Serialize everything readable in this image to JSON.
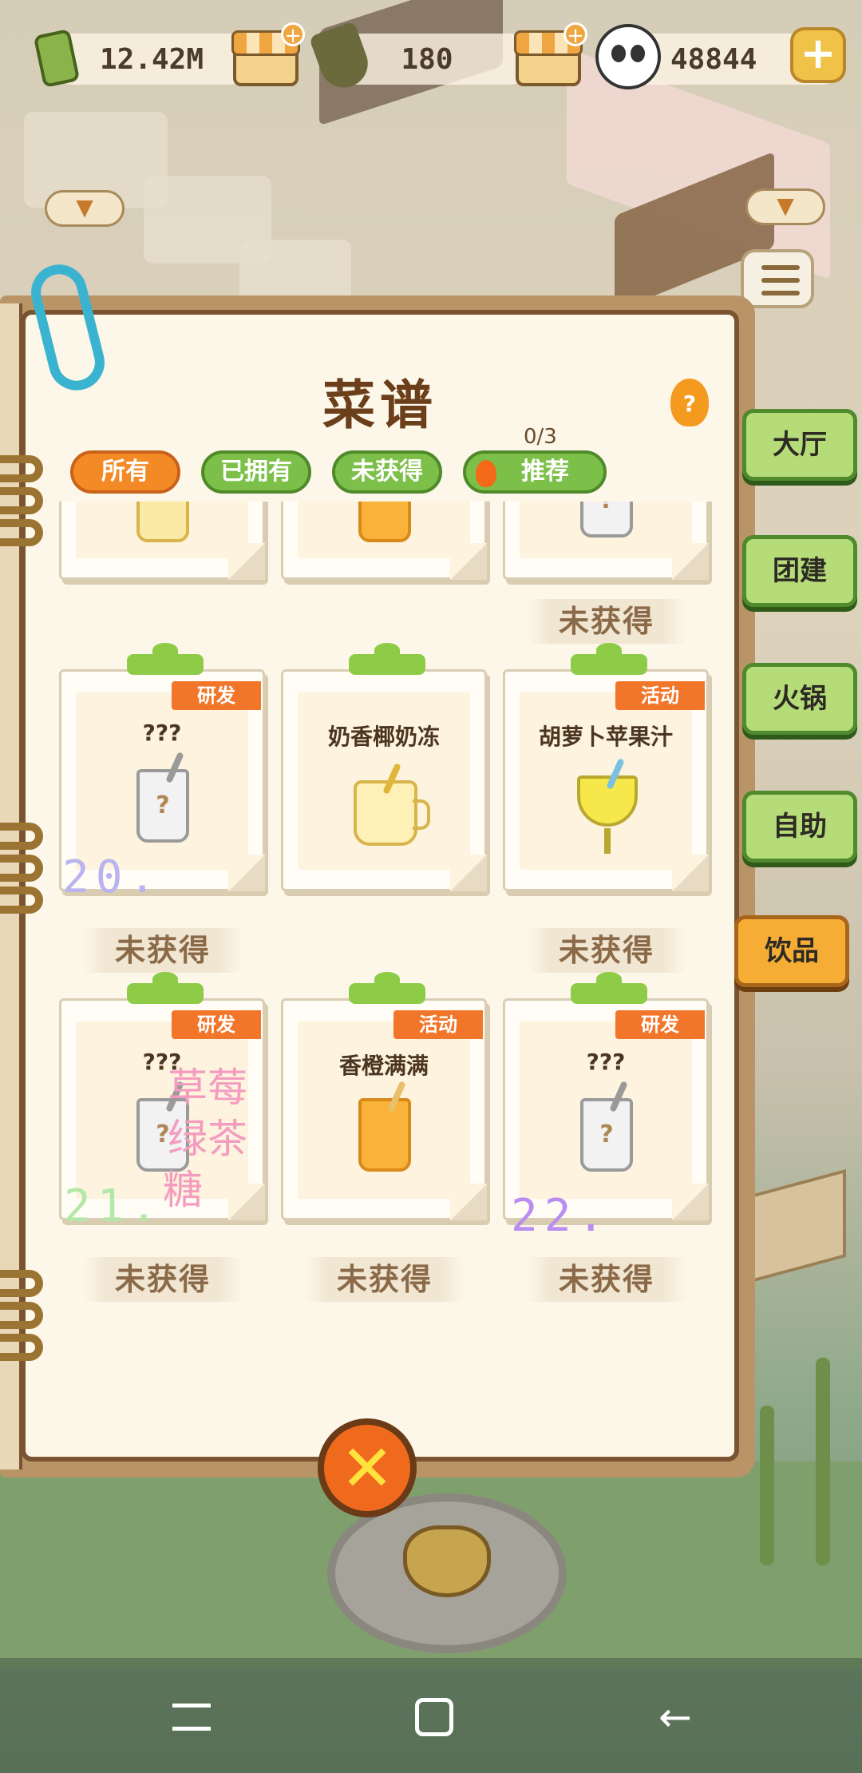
{
  "resources": {
    "money": "12.42M",
    "gems": "180",
    "pandas": "48844",
    "add_symbol": "+"
  },
  "dropdown_symbol": "▼",
  "book": {
    "title": "菜谱",
    "help_symbol": "?",
    "recommend_count": "0/3",
    "tabs": [
      {
        "label": "所有",
        "active": true
      },
      {
        "label": "已拥有",
        "active": false
      },
      {
        "label": "未获得",
        "active": false
      },
      {
        "label": "推荐",
        "active": false
      }
    ],
    "partial_top_row_status": "未获得",
    "rows": [
      [
        {
          "tag": "研发",
          "name": "???",
          "cup_symbol": "?",
          "status": "未获得"
        },
        {
          "tag": "",
          "name": "奶香椰奶冻",
          "cup_symbol": "",
          "status": ""
        },
        {
          "tag": "活动",
          "name": "胡萝卜苹果汁",
          "cup_symbol": "",
          "status": "未获得"
        }
      ],
      [
        {
          "tag": "研发",
          "name": "???",
          "cup_symbol": "?",
          "status": "未获得"
        },
        {
          "tag": "活动",
          "name": "香橙满满",
          "cup_symbol": "",
          "status": "未获得"
        },
        {
          "tag": "研发",
          "name": "???",
          "cup_symbol": "?",
          "status": "未获得"
        }
      ]
    ]
  },
  "overlays": {
    "num_20": "20.",
    "num_21": "21.",
    "num_22": "22.",
    "cn_line1": "草莓",
    "cn_line2": "绿茶",
    "cn_line3": "糖"
  },
  "side_tabs": [
    "大厅",
    "团建",
    "火锅",
    "自助",
    "饮品"
  ],
  "active_side_tab": "饮品",
  "close_symbol": "✕"
}
